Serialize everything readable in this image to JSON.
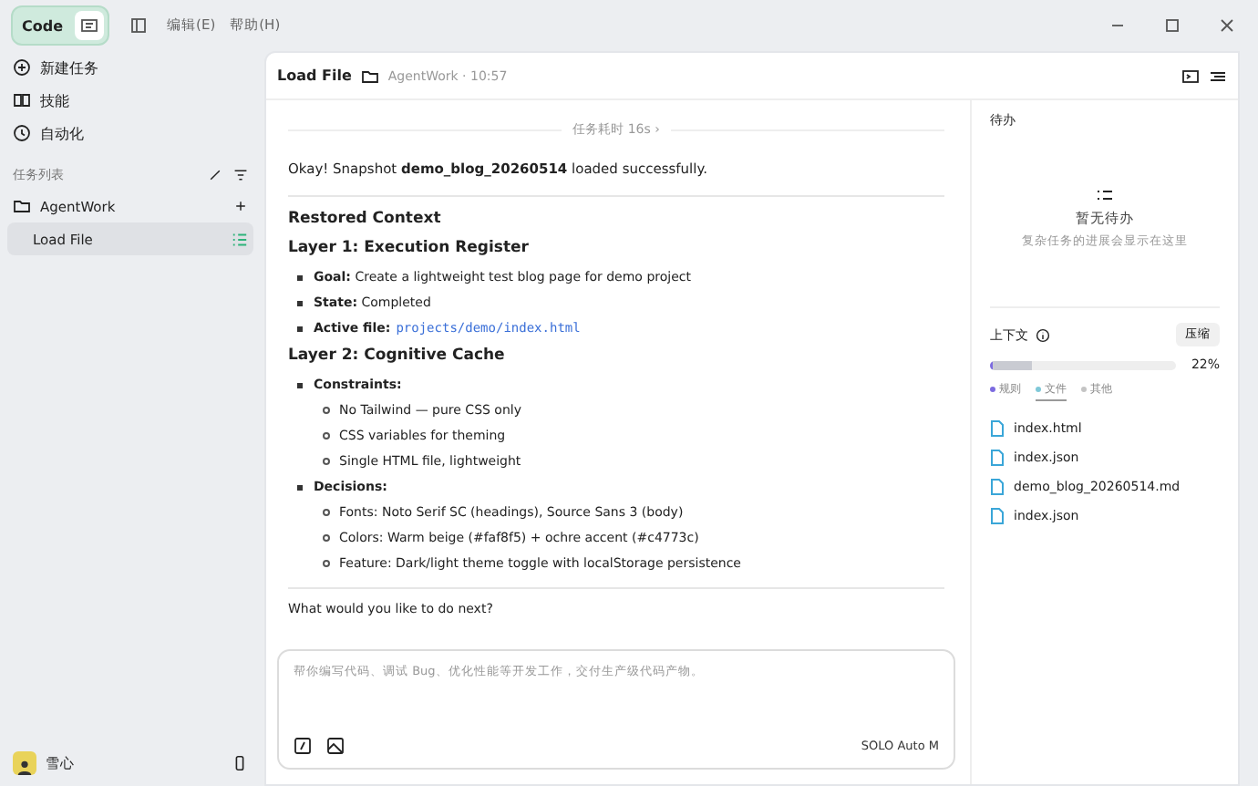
{
  "titlebar": {
    "mode": {
      "label": "Code",
      "selected": true
    },
    "menus": [
      "编辑(E)",
      "帮助(H)"
    ]
  },
  "sidebar": {
    "nav": [
      {
        "label": "新建任务"
      },
      {
        "label": "技能"
      },
      {
        "label": "自动化"
      }
    ],
    "task_list_title": "任务列表",
    "projects": [
      {
        "name": "AgentWork",
        "children": [
          {
            "name": "Load File",
            "selected": true
          }
        ]
      }
    ],
    "user": {
      "name": "雪心"
    }
  },
  "chat": {
    "title": "Load File",
    "folder": "AgentWork · 10:57",
    "duration": "任务耗时 16s ›",
    "intro": "Okay! Snapshot **demo_blog_20260514** loaded successfully.",
    "blocks": [
      {
        "kind": "title",
        "text": "Restored Context"
      },
      {
        "kind": "heading",
        "text": "Layer 1: Execution Register"
      },
      {
        "kind": "list",
        "items": [
          {
            "label": "Goal:",
            "text": "Create a lightweight test blog page for demo project"
          },
          {
            "label": "State:",
            "text": "Completed"
          },
          {
            "label": "Active file:",
            "code": "projects/demo/index.html"
          }
        ]
      },
      {
        "kind": "heading",
        "text": "Layer 2: Cognitive Cache"
      },
      {
        "kind": "list",
        "items": [
          {
            "label": "Constraints:",
            "children": [
              "No Tailwind — pure CSS only",
              "CSS variables for theming",
              "Single HTML file, lightweight"
            ]
          },
          {
            "label": "Decisions:",
            "children": [
              "Fonts: Noto Serif SC (headings), Source Sans 3 (body)",
              "Colors: Warm beige (#faf8f5) + ochre accent (#c4773c)",
              "Feature: Dark/light theme toggle with localStorage persistence"
            ]
          }
        ]
      }
    ],
    "question": "What would you like to do next?",
    "composer": {
      "placeholder": "帮你编写代码、调试 Bug、优化性能等开发工作，交付生产级代码产物。",
      "mode_label": "SOLO Auto M"
    }
  },
  "right": {
    "todo": {
      "title": "待办",
      "empty_title": "暂无待办",
      "empty_hint": "复杂任务的进展会显示在这里"
    },
    "context": {
      "title": "上下文",
      "compress": "压缩",
      "level": 0.22,
      "reading": "22%",
      "legend": [
        {
          "label": "规则",
          "color": "#7c6be0",
          "selected": false
        },
        {
          "label": "文件",
          "color": "#7fc8d8",
          "selected": true
        },
        {
          "label": "其他",
          "color": "#c4c4c4",
          "selected": false
        }
      ],
      "files": [
        "index.html",
        "index.json",
        "demo_blog_20260514.md",
        "index.json"
      ]
    }
  }
}
